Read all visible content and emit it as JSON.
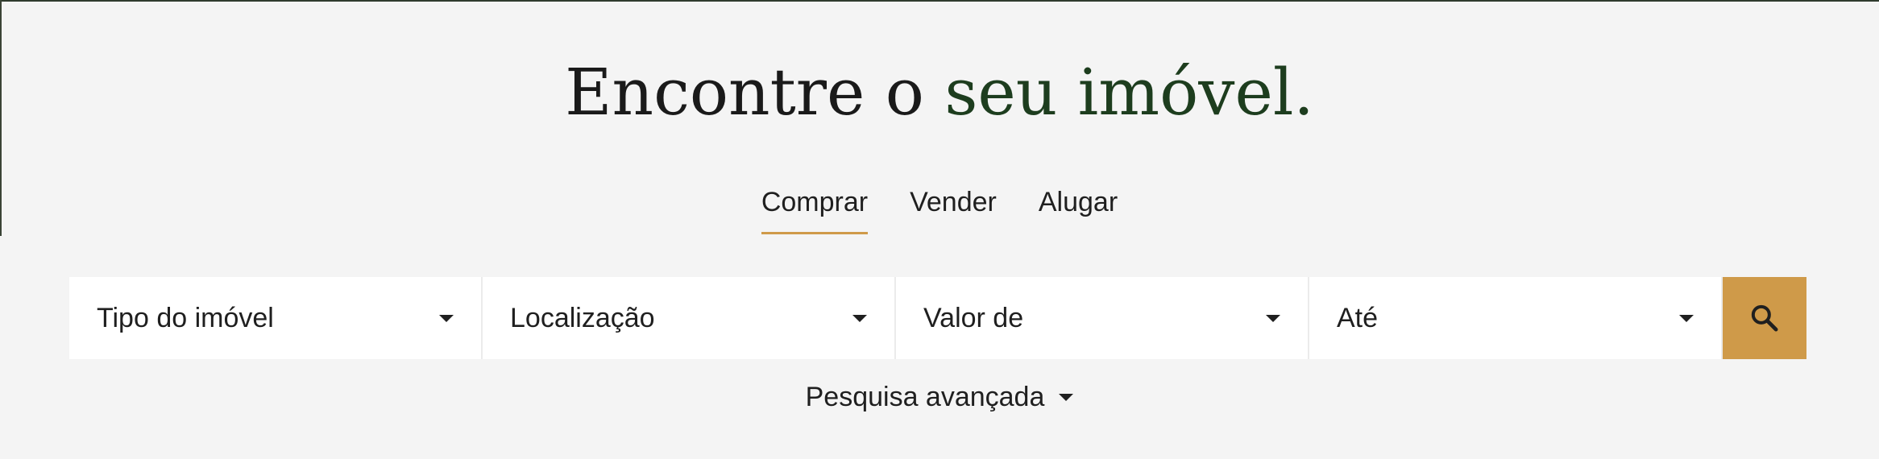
{
  "headline": {
    "part1": "Encontre o ",
    "part2": "seu imóvel."
  },
  "tabs": [
    {
      "label": "Comprar",
      "active": true
    },
    {
      "label": "Vender",
      "active": false
    },
    {
      "label": "Alugar",
      "active": false
    }
  ],
  "search": {
    "fields": [
      {
        "label": "Tipo do imóvel"
      },
      {
        "label": "Localização"
      },
      {
        "label": "Valor de"
      },
      {
        "label": "Até"
      }
    ],
    "button_icon": "search-icon"
  },
  "advanced_search": {
    "label": "Pesquisa avançada",
    "icon": "chevron-down-icon"
  },
  "colors": {
    "background": "#f4f4f4",
    "accent_gold": "#cf9a49",
    "headline_green": "#1d3d1e",
    "text": "#1f1f1f"
  }
}
